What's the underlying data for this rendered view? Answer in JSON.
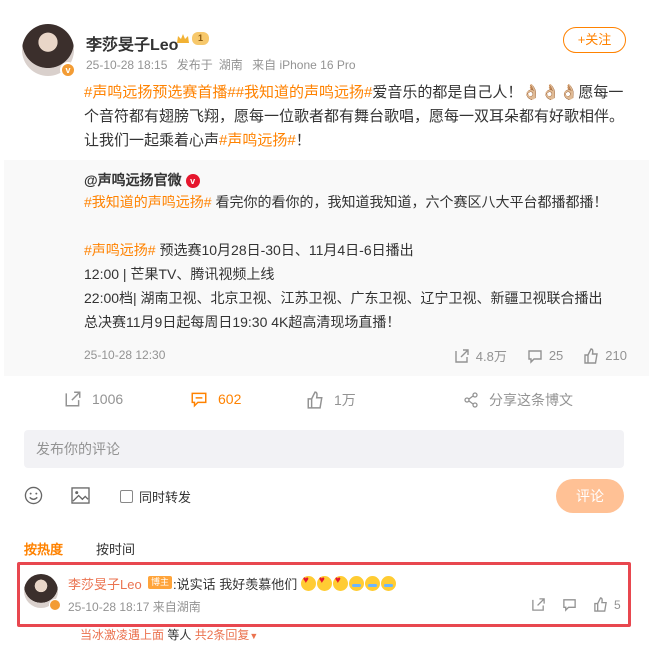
{
  "post": {
    "author": "李莎旻子Leo",
    "vip_level": "1",
    "time": "25-10-28 18:15",
    "posted_from_prefix": "发布于",
    "location": "湖南",
    "device": "来自 iPhone 16 Pro",
    "follow_label": "+关注",
    "text_parts": [
      {
        "type": "tag",
        "text": "#声鸣远扬预选赛首播#"
      },
      {
        "type": "tag",
        "text": "#我知道的声鸣远扬#"
      },
      {
        "type": "text",
        "text": "爱音乐的都是自己人！👌🏼👌🏼👌🏼愿每一个音符都有翅膀飞翔，愿每一位歌者都有舞台歌唱，愿每一双耳朵都有好歌相伴。让我们一起乘着心声"
      },
      {
        "type": "tag",
        "text": "#声鸣远扬#"
      },
      {
        "type": "text",
        "text": "！"
      }
    ]
  },
  "repost": {
    "author": "@声鸣远扬官微",
    "line1_tag": "#我知道的声鸣远扬#",
    "line1_text": " 看完你的看你的，我知道我知道，六个赛区八大平台都播都播！",
    "line2_tag": "#声鸣远扬#",
    "line2_text": " 预选赛10月28日-30日、11月4日-6日播出",
    "line3": "12:00 | 芒果TV、腾讯视频上线",
    "line4": "22:00档| 湖南卫视、北京卫视、江苏卫视、广东卫视、辽宁卫视、新疆卫视联合播出",
    "line5": "总决赛11月9日起每周日19:30 4K超高清现场直播！",
    "time": "25-10-28 12:30",
    "forwards": "4.8万",
    "comments": "25",
    "likes": "210"
  },
  "actions": {
    "forwards": "1006",
    "comments": "602",
    "likes": "1万",
    "share": "分享这条博文"
  },
  "composer": {
    "placeholder": "发布你的评论",
    "repost_label": "同时转发",
    "submit": "评论"
  },
  "tabs": {
    "hot": "按热度",
    "time": "按时间"
  },
  "comment": {
    "author": "李莎旻子Leo",
    "badge": "博主",
    "text": ":说实话 我好羡慕他们",
    "time": "25-10-28 18:17",
    "location": "来自湖南",
    "likes": "5"
  },
  "next_reply": {
    "author": "当冰激凌遇上面",
    "text": " 等人",
    "more": "共2条回复"
  },
  "colors": {
    "accent": "#ff8200",
    "highlight_border": "#e8474f",
    "meta": "#939393"
  }
}
